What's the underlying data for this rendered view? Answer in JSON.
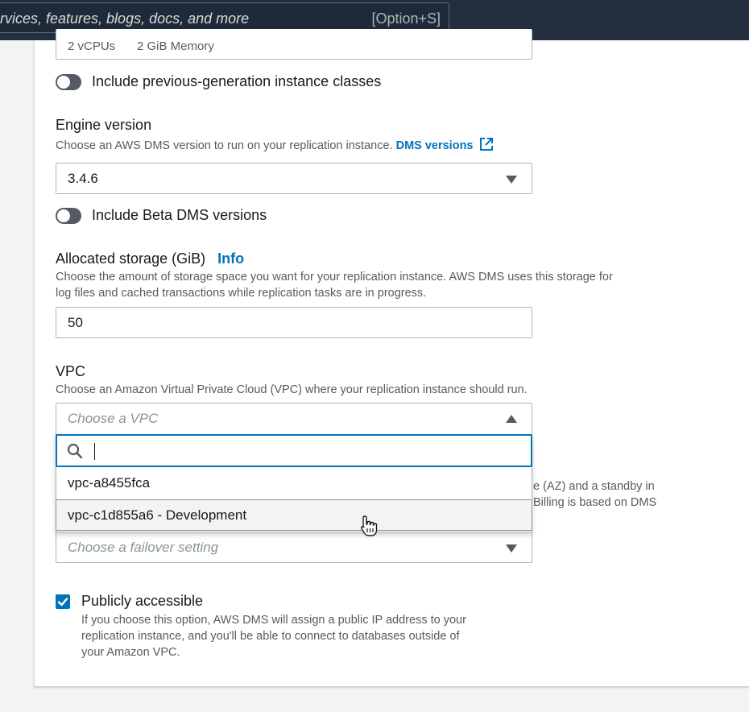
{
  "search": {
    "placeholder": "rvices, features, blogs, docs, and more",
    "shortcut": "[Option+S]"
  },
  "instance_class": {
    "summary_vcpus": "2 vCPUs",
    "summary_memory": "2 GiB Memory",
    "prev_gen_toggle_label": "Include previous-generation instance classes"
  },
  "engine_version": {
    "label": "Engine version",
    "description": "Choose an AWS DMS version to run on your replication instance.",
    "link": "DMS versions",
    "value": "3.4.6",
    "beta_toggle_label": "Include Beta DMS versions"
  },
  "storage": {
    "label": "Allocated storage (GiB)",
    "info": "Info",
    "description_line1": "Choose the amount of storage space you want for your replication instance. AWS DMS uses this storage for",
    "description_line2": "log files and cached transactions while replication tasks are in progress.",
    "value": "50"
  },
  "vpc": {
    "label": "VPC",
    "description": "Choose an Amazon Virtual Private Cloud (VPC) where your replication instance should run.",
    "placeholder": "Choose a VPC",
    "options": [
      "vpc-a8455fca",
      "vpc-c1d855a6 - Development"
    ]
  },
  "multi_az": {
    "description_fragment_1": "e (AZ) and a standby in",
    "description_fragment_2": "Billing is based on DMS",
    "placeholder": "Choose a failover setting"
  },
  "public": {
    "label": "Publicly accessible",
    "checked": true,
    "description_line1": "If you choose this option, AWS DMS will assign a public IP address to your",
    "description_line2": "replication instance, and you'll be able to connect to databases outside of",
    "description_line3": "your Amazon VPC."
  },
  "colors": {
    "accent": "#0073bb",
    "topbar": "#232f3e"
  }
}
